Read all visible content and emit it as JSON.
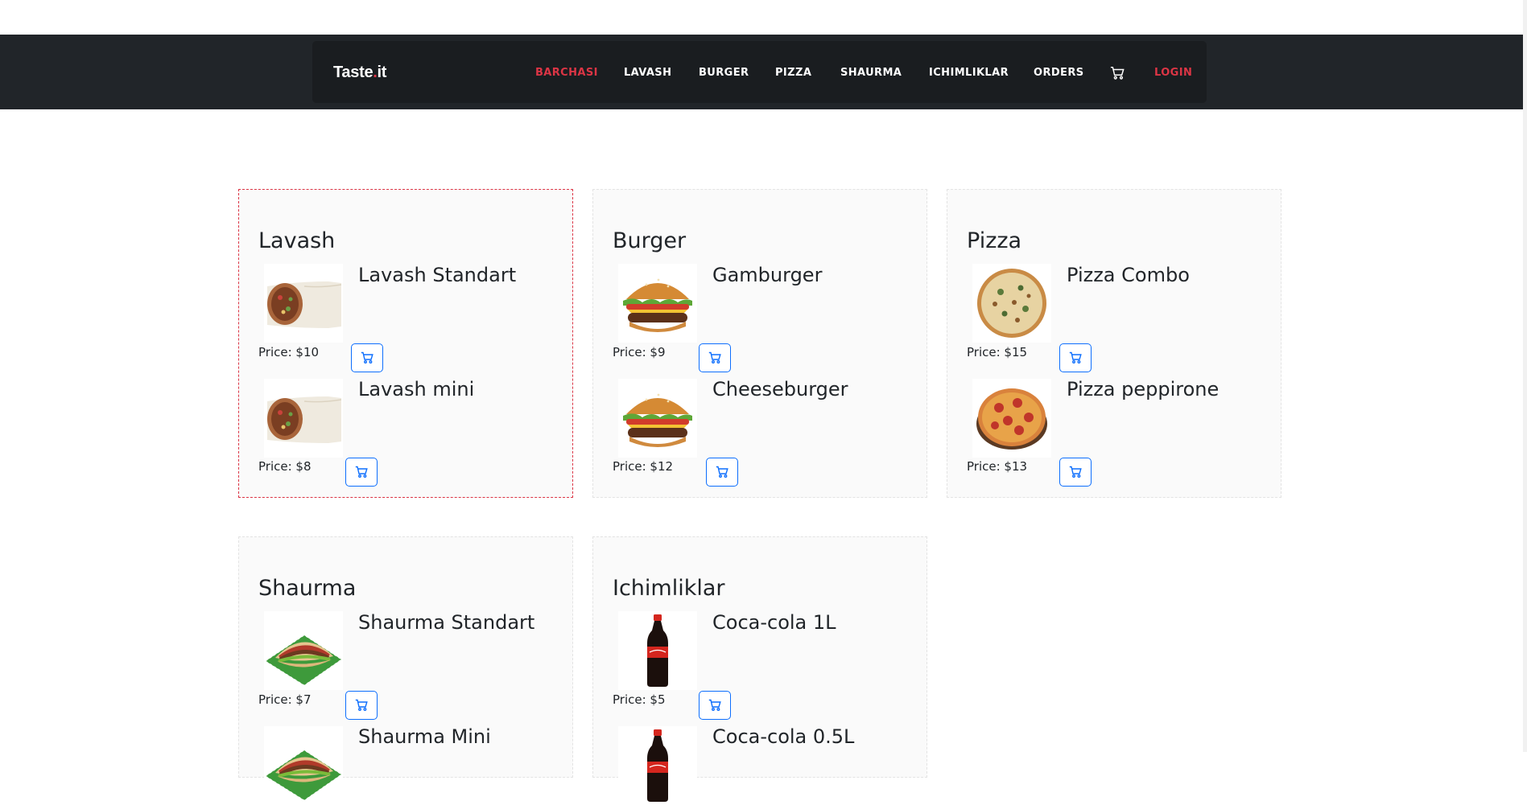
{
  "navbar": {
    "brand_main": "Taste",
    "brand_dot": ".",
    "brand_suffix": "it",
    "links": [
      {
        "label": "BARCHASI",
        "active": true
      },
      {
        "label": "LAVASH"
      },
      {
        "label": "BURGER"
      },
      {
        "label": "PIZZA"
      },
      {
        "label": "SHAURMA"
      },
      {
        "label": "ICHIMLIKLAR"
      },
      {
        "label": "ORDERS"
      }
    ],
    "cart_icon": "cart-icon",
    "login_label": "LOGIN"
  },
  "categories": [
    {
      "title": "Lavash",
      "items": [
        {
          "name": "Lavash Standart",
          "price": "Price: $10",
          "image": "lavash-image"
        },
        {
          "name": "Lavash mini",
          "price": "Price: $8",
          "image": "lavash-image"
        }
      ]
    },
    {
      "title": "Burger",
      "items": [
        {
          "name": "Gamburger",
          "price": "Price: $9",
          "image": "burger-image"
        },
        {
          "name": "Cheeseburger",
          "price": "Price: $12",
          "image": "burger-image"
        }
      ]
    },
    {
      "title": "Pizza",
      "items": [
        {
          "name": "Pizza Combo",
          "price": "Price: $15",
          "image": "pizza-combo-image"
        },
        {
          "name": "Pizza peppirone",
          "price": "Price: $13",
          "image": "pizza-pepperoni-image"
        }
      ]
    },
    {
      "title": "Shaurma",
      "items": [
        {
          "name": "Shaurma Standart",
          "price": "Price: $7",
          "image": "shaurma-image"
        },
        {
          "name": "Shaurma Mini",
          "price": "",
          "image": "shaurma-image"
        }
      ]
    },
    {
      "title": "Ichimliklar",
      "items": [
        {
          "name": "Coca-cola 1L",
          "price": "Price: $5",
          "image": "cola-bottle-image"
        },
        {
          "name": "Coca-cola 0.5L",
          "price": "",
          "image": "cola-bottle-image"
        }
      ]
    }
  ],
  "colors": {
    "navbar_bg": "#212529",
    "accent_red": "#dc3545",
    "button_blue": "#0d6efd"
  }
}
